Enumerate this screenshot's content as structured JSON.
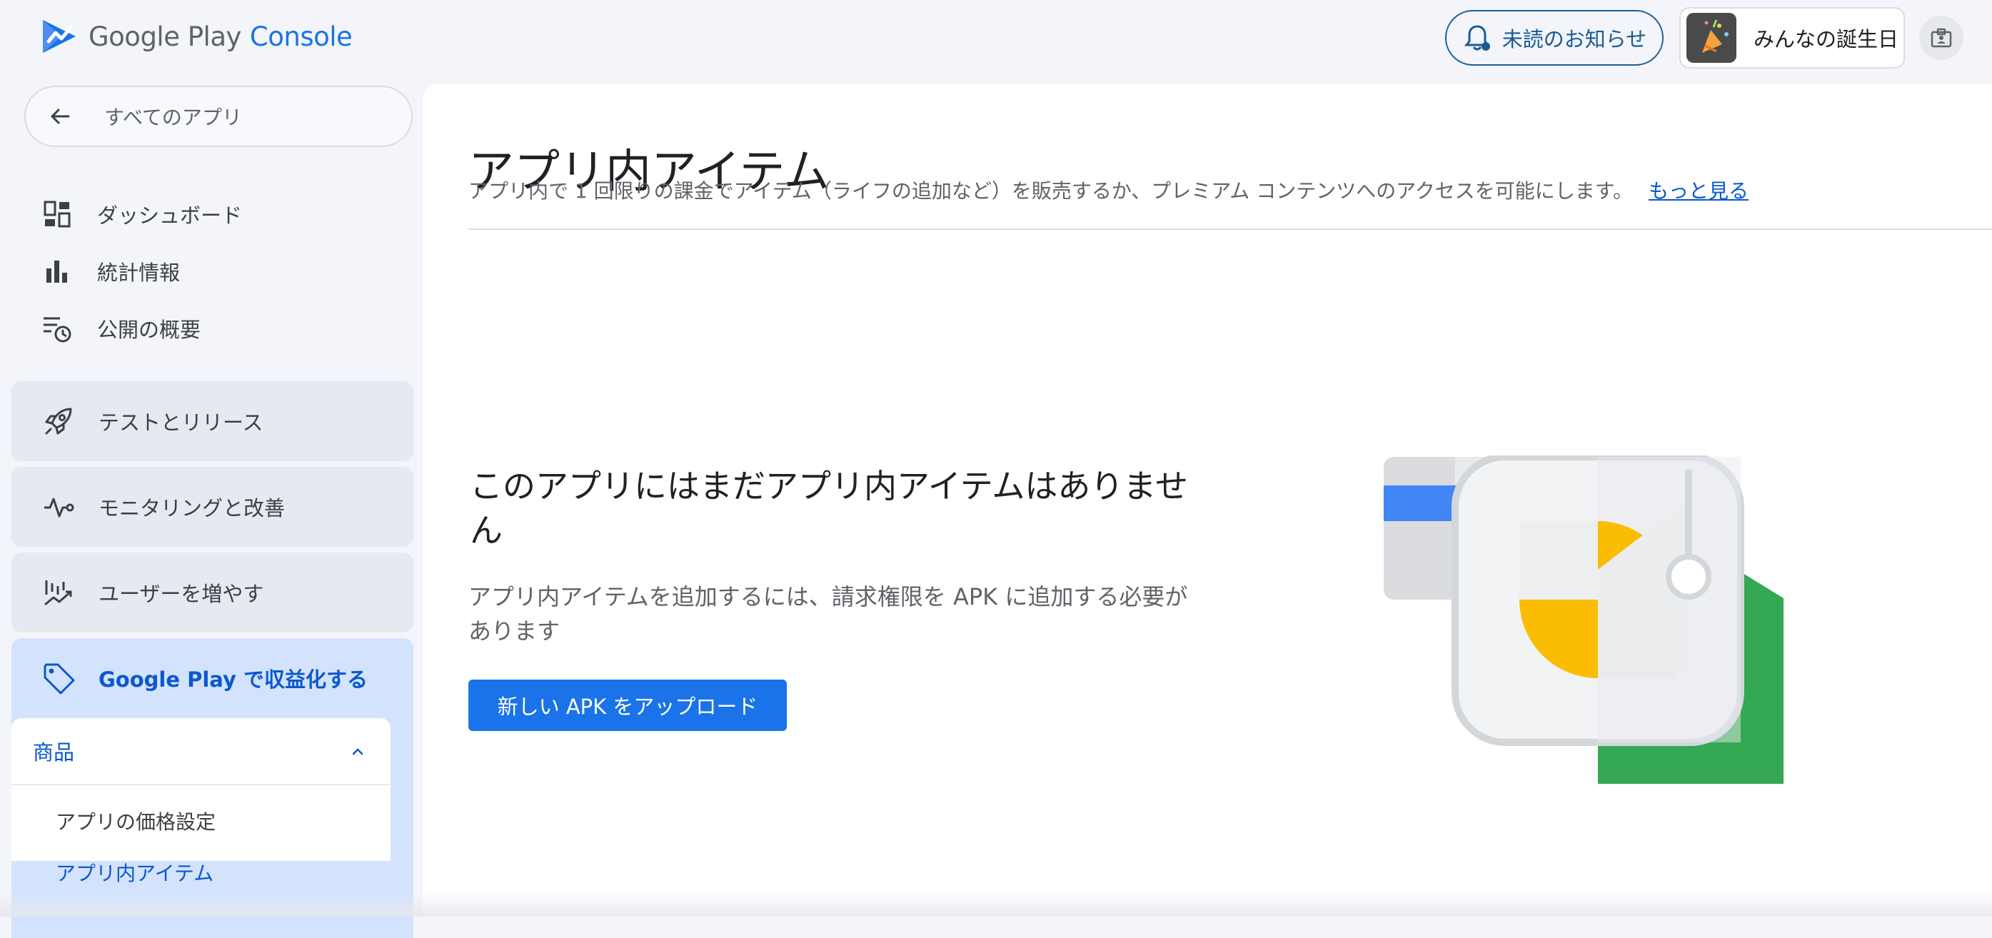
{
  "header": {
    "brand_google_play": "Google Play",
    "brand_console": "Console",
    "notifications_label": "未読のお知らせ",
    "app_name": "みんなの誕生日"
  },
  "sidebar": {
    "back_label": "すべてのアプリ",
    "items": [
      {
        "label": "ダッシュボード",
        "icon": "dashboard-icon"
      },
      {
        "label": "統計情報",
        "icon": "bar-chart-icon"
      },
      {
        "label": "公開の概要",
        "icon": "publishing-overview-icon"
      }
    ],
    "sections": [
      {
        "label": "テストとリリース",
        "icon": "rocket-icon"
      },
      {
        "label": "モニタリングと改善",
        "icon": "vitals-icon"
      },
      {
        "label": "ユーザーを増やす",
        "icon": "growth-icon"
      },
      {
        "label": "Google Play で収益化する",
        "icon": "tag-icon"
      }
    ],
    "monetize": {
      "group_label": "商品",
      "sub_items": [
        {
          "label": "アプリの価格設定"
        },
        {
          "label": "アプリ内アイテム"
        }
      ]
    }
  },
  "main": {
    "title": "アプリ内アイテム",
    "description": "アプリ内で 1 回限りの課金でアイテム（ライフの追加など）を販売するか、プレミアム コンテンツへのアクセスを可能にします。",
    "learn_more": "もっと見る",
    "empty_title": "このアプリにはまだアプリ内アイテムはありません",
    "empty_desc": "アプリ内アイテムを追加するには、請求権限を APK に追加する必要があります",
    "upload_button": "新しい APK をアップロード"
  },
  "colors": {
    "accent": "#1a73e8",
    "active_nav_bg": "#d3e3fd",
    "illustration_yellow": "#fbbc04",
    "illustration_green": "#34a853",
    "illustration_blue": "#4285f4"
  }
}
